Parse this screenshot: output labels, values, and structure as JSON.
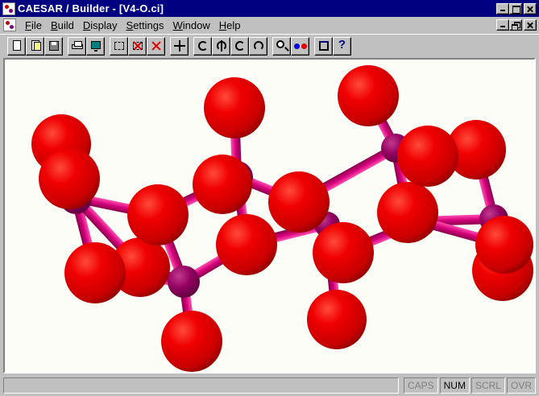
{
  "window": {
    "title": "CAESAR / Builder - [V4-O.ci]"
  },
  "menu": [
    {
      "label_u": "F",
      "label_rest": "ile"
    },
    {
      "label_u": "B",
      "label_rest": "uild"
    },
    {
      "label_u": "D",
      "label_rest": "isplay"
    },
    {
      "label_u": "S",
      "label_rest": "ettings"
    },
    {
      "label_u": "W",
      "label_rest": "indow"
    },
    {
      "label_u": "H",
      "label_rest": "elp"
    }
  ],
  "toolbar": {
    "help_glyph": "?"
  },
  "status": {
    "caps": "CAPS",
    "num": "NUM",
    "scrl": "SCRL",
    "ovr": "OVR"
  },
  "colors": {
    "oxygen": "#e00000",
    "vanadium": "#990066",
    "bond": "#d4007a"
  }
}
